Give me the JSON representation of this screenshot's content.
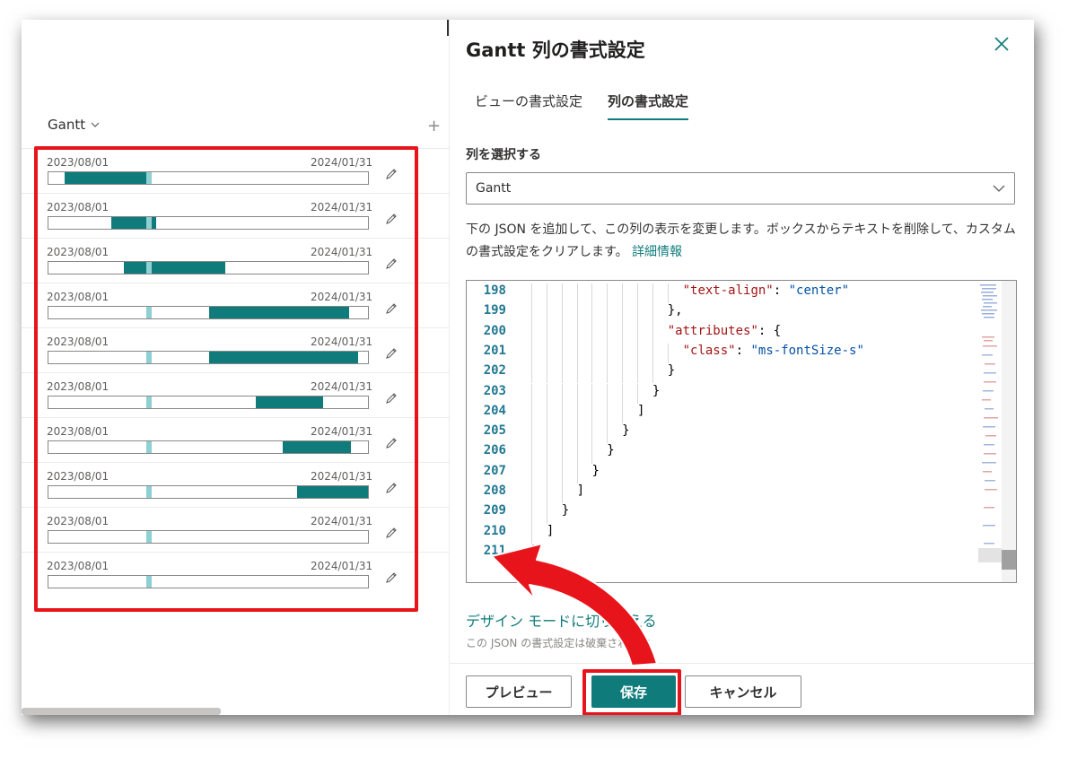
{
  "list": {
    "column_header": "Gantt",
    "rows": [
      {
        "start_label": "2023/08/01",
        "end_label": "2024/01/31",
        "fill_from": 0.05,
        "fill_to": 0.31
      },
      {
        "start_label": "2023/08/01",
        "end_label": "2024/01/31",
        "fill_from": 0.195,
        "fill_to": 0.335
      },
      {
        "start_label": "2023/08/01",
        "end_label": "2024/01/31",
        "fill_from": 0.235,
        "fill_to": 0.55
      },
      {
        "start_label": "2023/08/01",
        "end_label": "2024/01/31",
        "fill_from": 0.5,
        "fill_to": 0.935
      },
      {
        "start_label": "2023/08/01",
        "end_label": "2024/01/31",
        "fill_from": 0.5,
        "fill_to": 0.965
      },
      {
        "start_label": "2023/08/01",
        "end_label": "2024/01/31",
        "fill_from": 0.645,
        "fill_to": 0.855
      },
      {
        "start_label": "2023/08/01",
        "end_label": "2024/01/31",
        "fill_from": 0.73,
        "fill_to": 0.94
      },
      {
        "start_label": "2023/08/01",
        "end_label": "2024/01/31",
        "fill_from": 0.775,
        "fill_to": 0.995
      },
      {
        "start_label": "2023/08/01",
        "end_label": "2024/01/31",
        "fill_from": null,
        "fill_to": null
      },
      {
        "start_label": "2023/08/01",
        "end_label": "2024/01/31",
        "fill_from": null,
        "fill_to": null
      }
    ],
    "today_marker": 0.305
  },
  "panel": {
    "title": "Gantt 列の書式設定",
    "tabs": [
      {
        "label": "ビューの書式設定",
        "active": false
      },
      {
        "label": "列の書式設定",
        "active": true
      }
    ],
    "select_label": "列を選択する",
    "select_value": "Gantt",
    "description": "下の JSON を追加して、この列の表示を変更します。ボックスからテキストを削除して、カスタムの書式設定をクリアします。",
    "description_link": "詳細情報",
    "code_lines": [
      {
        "num": "198",
        "indent": 12,
        "parts": [
          [
            "k",
            "\"text-align\""
          ],
          [
            "p",
            ": "
          ],
          [
            "s",
            "\"center\""
          ]
        ]
      },
      {
        "num": "199",
        "indent": 11,
        "parts": [
          [
            "p",
            "},"
          ]
        ]
      },
      {
        "num": "200",
        "indent": 11,
        "parts": [
          [
            "k",
            "\"attributes\""
          ],
          [
            "p",
            ": {"
          ]
        ]
      },
      {
        "num": "201",
        "indent": 12,
        "parts": [
          [
            "k",
            "\"class\""
          ],
          [
            "p",
            ": "
          ],
          [
            "s",
            "\"ms-fontSize-s\""
          ]
        ]
      },
      {
        "num": "202",
        "indent": 11,
        "parts": [
          [
            "p",
            "}"
          ]
        ]
      },
      {
        "num": "203",
        "indent": 10,
        "parts": [
          [
            "p",
            "}"
          ]
        ]
      },
      {
        "num": "204",
        "indent": 9,
        "parts": [
          [
            "p",
            "]"
          ]
        ]
      },
      {
        "num": "205",
        "indent": 8,
        "parts": [
          [
            "p",
            "}"
          ]
        ]
      },
      {
        "num": "206",
        "indent": 7,
        "parts": [
          [
            "p",
            "}"
          ]
        ]
      },
      {
        "num": "207",
        "indent": 6,
        "parts": [
          [
            "p",
            "}"
          ]
        ]
      },
      {
        "num": "208",
        "indent": 5,
        "parts": [
          [
            "p",
            "]"
          ]
        ]
      },
      {
        "num": "209",
        "indent": 4,
        "parts": [
          [
            "p",
            "}"
          ]
        ]
      },
      {
        "num": "210",
        "indent": 3,
        "parts": [
          [
            "p",
            "]"
          ]
        ]
      },
      {
        "num": "211",
        "indent": 2,
        "parts": [
          [
            "p",
            "}"
          ]
        ]
      }
    ],
    "switch_link": "デザイン モードに切り替える",
    "switch_note": "この JSON の書式設定は破棄されます",
    "buttons": {
      "preview": "プレビュー",
      "save": "保存",
      "cancel": "キャンセル"
    }
  },
  "colors": {
    "accent": "#0f7b7b",
    "today": "#8ed0d3",
    "highlight": "#e8141b"
  },
  "icons": [
    "chevron-down-icon",
    "plus-icon",
    "pencil-icon",
    "close-icon",
    "arrow-annotation"
  ]
}
